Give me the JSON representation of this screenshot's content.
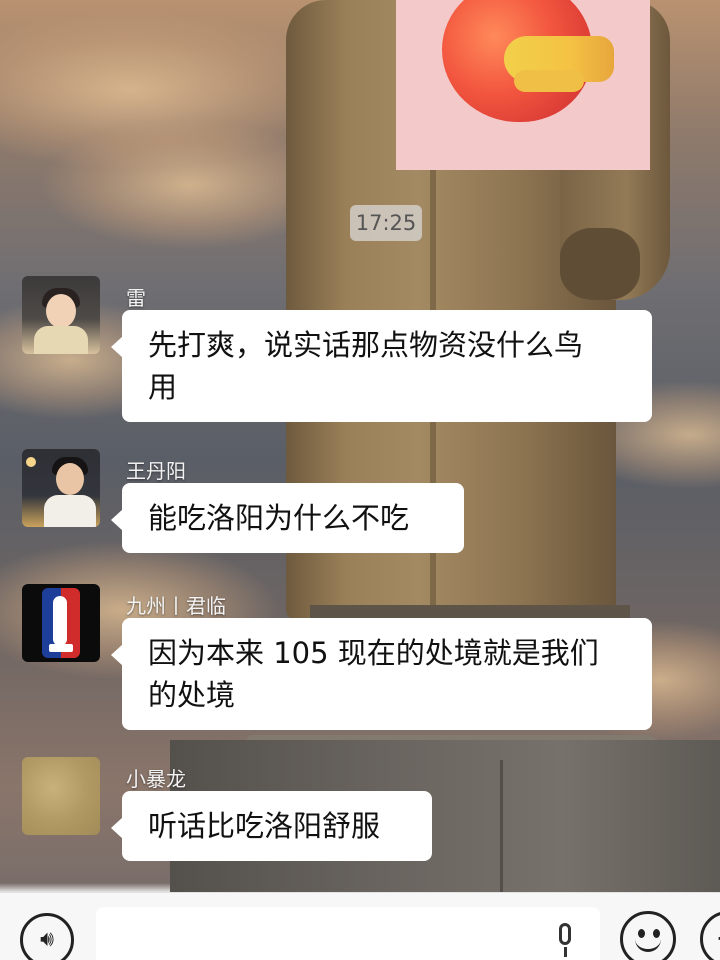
{
  "timestamp": "17:25",
  "messages": [
    {
      "sender": "雷",
      "text_line1": "先打爽，说实话那点物资没什么鸟",
      "text_line2": "用"
    },
    {
      "sender": "王丹阳",
      "text_line1": "能吃洛阳为什么不吃"
    },
    {
      "sender": "九州丨君临",
      "text_line1": "因为本来 105 现在的处境就是我们",
      "text_line2": "的处境"
    },
    {
      "sender": "小暴龙",
      "text_line1": "听话比吃洛阳舒服"
    }
  ],
  "input_bar": {
    "voice_icon": "voice-wave-icon",
    "mic_icon": "microphone-icon",
    "emoji_icon": "smiley-face-icon",
    "more_icon": "plus-icon"
  }
}
